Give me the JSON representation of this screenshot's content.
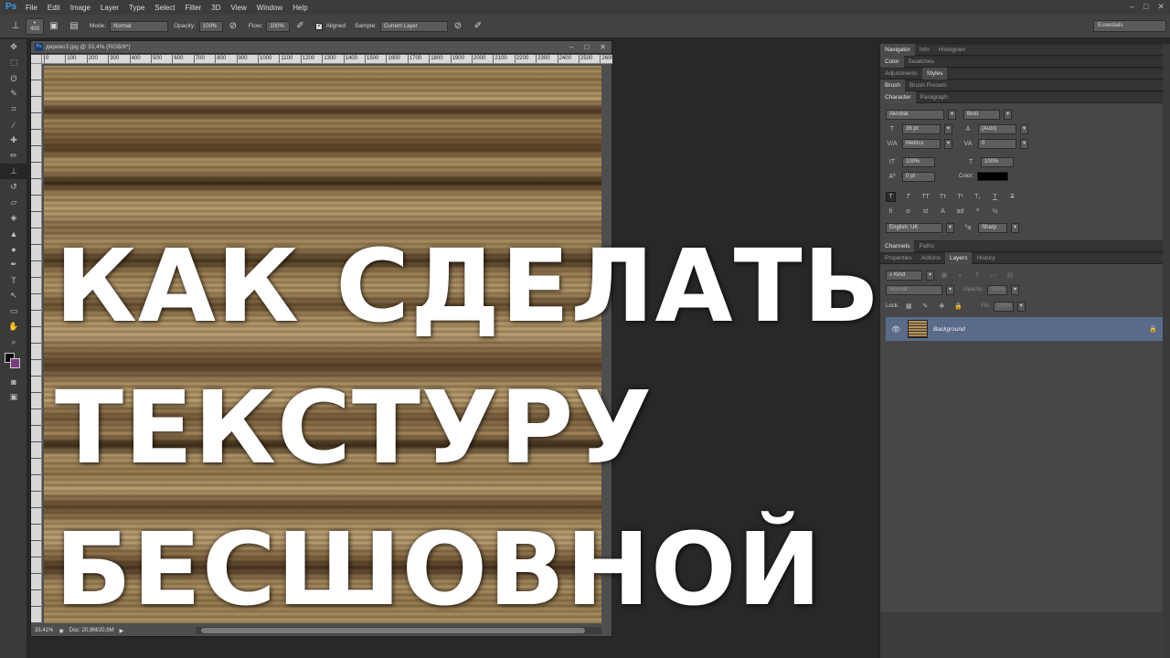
{
  "app": {
    "logo": "Ps"
  },
  "menu": [
    "File",
    "Edit",
    "Image",
    "Layer",
    "Type",
    "Select",
    "Filter",
    "3D",
    "View",
    "Window",
    "Help"
  ],
  "window_controls": [
    "–",
    "□",
    "✕"
  ],
  "options_bar": {
    "brush_size": "400",
    "mode_label": "Mode:",
    "mode_value": "Normal",
    "opacity_label": "Opacity:",
    "opacity_value": "100%",
    "flow_label": "Flow:",
    "flow_value": "100%",
    "aligned_label": "Aligned",
    "sample_label": "Sample:",
    "sample_value": "Current Layer",
    "workspace": "Essentials"
  },
  "document": {
    "tab_title": "дерево3.jpg @ 33,4% (RGB/8*)",
    "ruler_ticks": [
      "0",
      "100",
      "200",
      "300",
      "400",
      "500",
      "600",
      "700",
      "800",
      "900",
      "1000",
      "1100",
      "1200",
      "1300",
      "1400",
      "1500",
      "1600",
      "1700",
      "1800",
      "1900",
      "2000",
      "2100",
      "2200",
      "2300",
      "2400",
      "2500",
      "2600"
    ],
    "zoom": "33,41%",
    "doc_size": "Doc: 20,9M/20,9M"
  },
  "overlay_text": {
    "line1": "КАК СДЕЛАТЬ",
    "line2": "ТЕКСТУРУ",
    "line3": "БЕСШОВНОЙ"
  },
  "panels": {
    "tabs_nav": [
      "Navigator",
      "Info",
      "Histogram"
    ],
    "tabs_color": [
      "Color",
      "Swatches"
    ],
    "tabs_adj": [
      "Adjustments",
      "Styles"
    ],
    "tabs_brush": [
      "Brush",
      "Brush Presets"
    ],
    "tabs_char": [
      "Character",
      "Paragraph"
    ],
    "character": {
      "font_family": "Akrobat",
      "font_style": "Bold",
      "font_size": "36 pt",
      "leading": "(Auto)",
      "kerning": "Metrics",
      "tracking": "0",
      "vscale": "100%",
      "hscale": "100%",
      "baseline": "0 pt",
      "color_label": "Color:",
      "color_value": "#000000",
      "language": "English: UK",
      "antialias": "Sharp"
    },
    "tabs_channels": [
      "Channels",
      "Paths"
    ],
    "tabs_layers": [
      "Properties",
      "Actions",
      "Layers",
      "History"
    ],
    "layers": {
      "kind": "Kind",
      "blend": "Normal",
      "opacity_label": "Opacity:",
      "opacity_value": "100%",
      "lock_label": "Lock:",
      "fill_label": "Fill:",
      "fill_value": "100%",
      "items": [
        {
          "name": "Background"
        }
      ]
    }
  }
}
